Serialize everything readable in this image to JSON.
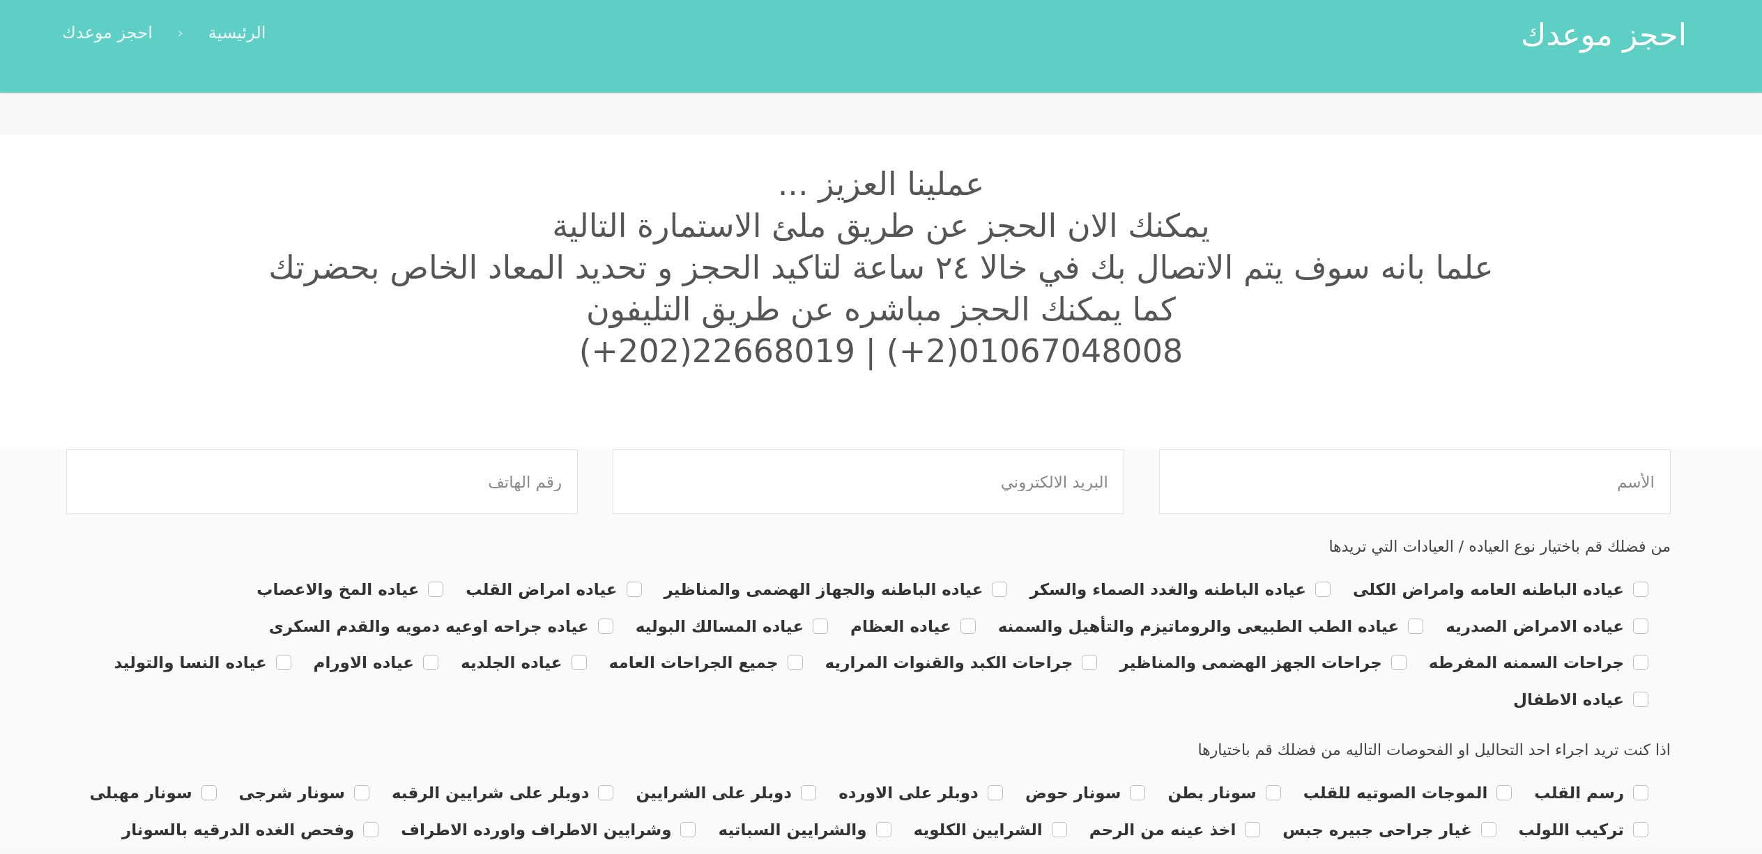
{
  "header": {
    "title": "احجز موعدك",
    "breadcrumb": {
      "items": [
        "الرئيسية",
        "احجز موعدك"
      ],
      "separator": "‹"
    }
  },
  "intro": {
    "lines": [
      {
        "kind": "text",
        "text": "عملينا العزيز ..."
      },
      {
        "kind": "text",
        "text": "يمكنك الان الحجز عن طريق ملئ الاستمارة التالية"
      },
      {
        "kind": "text",
        "text": "علما بانه سوف يتم الاتصال بك في خالا ٢٤ ساعة لتاكيد الحجز و تحديد المعاد الخاص بحضرتك"
      },
      {
        "kind": "text",
        "text": "كما يمكنك الحجز مباشره عن طريق التليفون"
      },
      {
        "kind": "phone",
        "text": "(+202)22668019 | (+2)01067048008"
      }
    ]
  },
  "form": {
    "fields": [
      {
        "placeholder": "الأسم"
      },
      {
        "placeholder": "البريد الالكتروني"
      },
      {
        "placeholder": "رقم الهاتف"
      }
    ],
    "groups": [
      {
        "prompt": "من فضلك قم باختيار نوع العياده / العيادات التي تريدها",
        "options": [
          {
            "label": "عياده الباطنه العامه وامراض الكلى",
            "checked": false
          },
          {
            "label": "عياده الباطنه والغدد الصماء والسكر",
            "checked": false
          },
          {
            "label": "عياده الباطنه والجهاز الهضمى والمناظير",
            "checked": false
          },
          {
            "label": "عياده امراض القلب",
            "checked": false
          },
          {
            "label": "عياده المخ والاعصاب",
            "checked": false
          },
          {
            "label": "عياده الامراض الصدريه",
            "checked": false
          },
          {
            "label": "عياده الطب الطبيعى والروماتيزم والتأهيل والسمنه",
            "checked": false
          },
          {
            "label": "عياده العظام",
            "checked": false
          },
          {
            "label": "عياده المسالك البوليه",
            "checked": false
          },
          {
            "label": "عياده جراحه اوعيه دمويه والقدم السكرى",
            "checked": false
          },
          {
            "label": "جراحات السمنه المفرطه",
            "checked": false
          },
          {
            "label": "جراحات الجهز الهضمى والمناظير",
            "checked": false
          },
          {
            "label": "جراحات الكبد والقنوات المراريه",
            "checked": false
          },
          {
            "label": "جميع الجراحات العامه",
            "checked": false
          },
          {
            "label": "عياده الجلديه",
            "checked": false
          },
          {
            "label": "عياده الاورام",
            "checked": false
          },
          {
            "label": "عياده النسا والتوليد",
            "checked": false
          },
          {
            "label": "عياده الاطفال",
            "checked": false
          }
        ]
      },
      {
        "prompt": "اذا كنت تريد اجراء احد التحاليل او الفحوصات التاليه من فضلك قم باختيارها",
        "options": [
          {
            "label": "رسم القلب",
            "checked": false
          },
          {
            "label": "الموجات الصوتيه للقلب",
            "checked": false
          },
          {
            "label": "سونار بطن",
            "checked": false
          },
          {
            "label": "سونار حوض",
            "checked": false
          },
          {
            "label": "دوبلر على الاورده",
            "checked": false
          },
          {
            "label": "دوبلر على الشرايين",
            "checked": false
          },
          {
            "label": "دوبلر على شرايين الرقبه",
            "checked": false
          },
          {
            "label": "سونار شرجى",
            "checked": false
          },
          {
            "label": "سونار مهبلى",
            "checked": false
          },
          {
            "label": "تركيب اللولب",
            "checked": false
          },
          {
            "label": "غيار جراحى جبيره جبس",
            "checked": false
          },
          {
            "label": "اخذ عينه من الرحم",
            "checked": false
          },
          {
            "label": "الشرايين الكلويه",
            "checked": false
          },
          {
            "label": "والشرايين السباتيه",
            "checked": false
          },
          {
            "label": "وشرايين الاطراف واورده الاطراف",
            "checked": false
          },
          {
            "label": "وفحص الغده الدرقيه بالسونار",
            "checked": false
          }
        ]
      }
    ]
  }
}
